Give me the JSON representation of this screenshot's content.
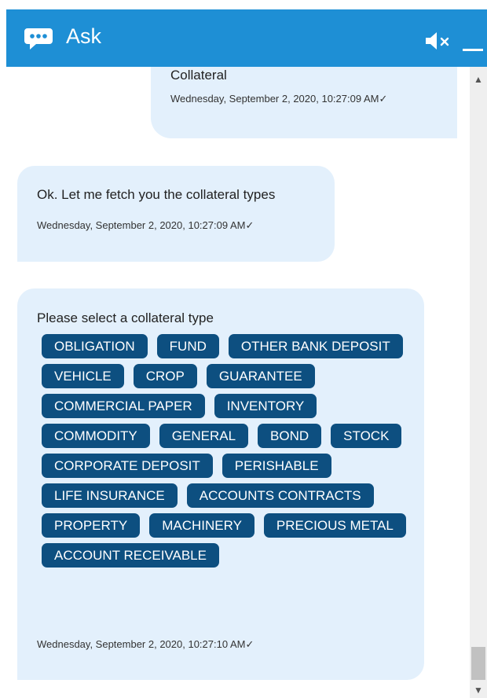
{
  "header": {
    "title": "Ask",
    "icons": {
      "chat": "chat-bubble-icon",
      "mute": "speaker-muted-icon",
      "minimize": "minimize-icon"
    },
    "color": "#1e8fd5"
  },
  "messages": [
    {
      "sender": "user",
      "text": "Collateral",
      "time": "Wednesday, September 2, 2020, 10:27:09 AM✓"
    },
    {
      "sender": "bot",
      "text": "Ok. Let me fetch you the collateral types",
      "time": "Wednesday, September 2, 2020, 10:27:09 AM✓"
    },
    {
      "sender": "bot",
      "text": "Please select a collateral type",
      "options": [
        "OBLIGATION",
        "FUND",
        "OTHER BANK DEPOSIT",
        "VEHICLE",
        "CROP",
        "GUARANTEE",
        "COMMERCIAL PAPER",
        "INVENTORY",
        "COMMODITY",
        "GENERAL",
        "BOND",
        "STOCK",
        "CORPORATE DEPOSIT",
        "PERISHABLE",
        "LIFE INSURANCE",
        "ACCOUNTS CONTRACTS",
        "PROPERTY",
        "MACHINERY",
        "PRECIOUS METAL",
        "ACCOUNT RECEIVABLE"
      ],
      "time": "Wednesday, September 2, 2020, 10:27:10 AM✓"
    }
  ],
  "colors": {
    "bubble": "#e3f0fc",
    "chip": "#0d4f80"
  }
}
